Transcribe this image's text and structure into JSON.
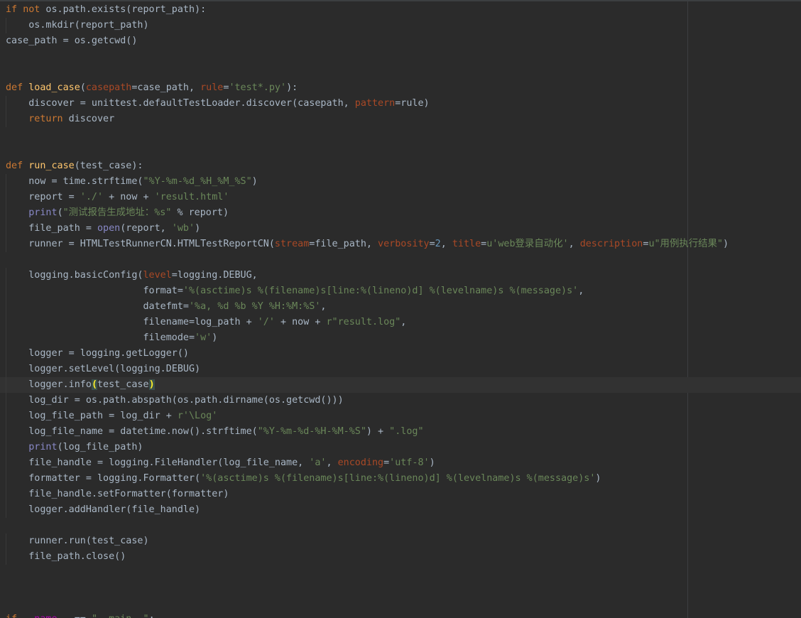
{
  "editor": {
    "language": "python",
    "theme": "dark",
    "current_line": 25,
    "lines": [
      "if not os.path.exists(report_path):",
      "    os.mkdir(report_path)",
      "case_path = os.getcwd()",
      "",
      "",
      "def load_case(casepath=case_path, rule='test*.py'):",
      "    discover = unittest.defaultTestLoader.discover(casepath, pattern=rule)",
      "    return discover",
      "",
      "",
      "def run_case(test_case):",
      "    now = time.strftime(\"%Y-%m-%d_%H_%M_%S\")",
      "    report = './' + now + 'result.html'",
      "    print(\"测试报告生成地址：%s\" % report)",
      "    file_path = open(report, 'wb')",
      "    runner = HTMLTestRunnerCN.HTMLTestReportCN(stream=file_path, verbosity=2, title=u'web登录自动化', description=u\"用例执行结果\")",
      "",
      "    logging.basicConfig(level=logging.DEBUG,",
      "                        format='%(asctime)s %(filename)s[line:%(lineno)d] %(levelname)s %(message)s',",
      "                        datefmt='%a, %d %b %Y %H:%M:%S',",
      "                        filename=log_path + '/' + now + r\"result.log\",",
      "                        filemode='w')",
      "    logger = logging.getLogger()",
      "    logger.setLevel(logging.DEBUG)",
      "    logger.info(test_case)",
      "    log_dir = os.path.abspath(os.path.dirname(os.getcwd()))",
      "    log_file_path = log_dir + r'\\Log'",
      "    log_file_name = datetime.now().strftime(\"%Y-%m-%d-%H-%M-%S\") + \".log\"",
      "    print(log_file_path)",
      "    file_handle = logging.FileHandler(log_file_name, 'a', encoding='utf-8')",
      "    formatter = logging.Formatter('%(asctime)s %(filename)s[line:%(lineno)d] %(levelname)s %(message)s')",
      "    file_handle.setFormatter(formatter)",
      "    logger.addHandler(file_handle)",
      "",
      "    runner.run(test_case)",
      "    file_path.close()",
      "",
      "",
      "",
      "if __name__ == \"__main__\":"
    ]
  },
  "theme_colors": {
    "background": "#2b2b2b",
    "text": "#a9b7c6",
    "keyword": "#cc7832",
    "function": "#ffc66d",
    "string": "#6a8759",
    "parameter": "#aa4926",
    "number": "#6897bb",
    "builtin": "#8888c6"
  }
}
